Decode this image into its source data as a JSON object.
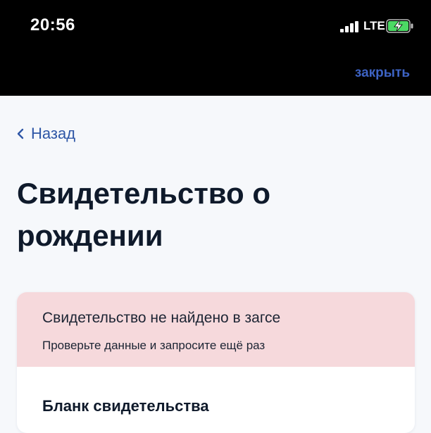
{
  "status_bar": {
    "time": "20:56",
    "network": "LTE",
    "icons": [
      "signal-bars-icon",
      "battery-charging-icon"
    ]
  },
  "header": {
    "close_label": "закрыть"
  },
  "nav": {
    "back_label": "Назад"
  },
  "page": {
    "title": "Свидетельство о рождении"
  },
  "alert": {
    "title": "Свидетельство не найдено в загсе",
    "subtitle": "Проверьте данные и запросите ещё раз"
  },
  "section": {
    "title": "Бланк свидетельства"
  },
  "colors": {
    "accent": "#3d63c4",
    "link": "#2e56a6",
    "alert_bg": "#f6d9dc",
    "page_bg": "#f6f8fb",
    "battery_charge": "#4cd964"
  }
}
